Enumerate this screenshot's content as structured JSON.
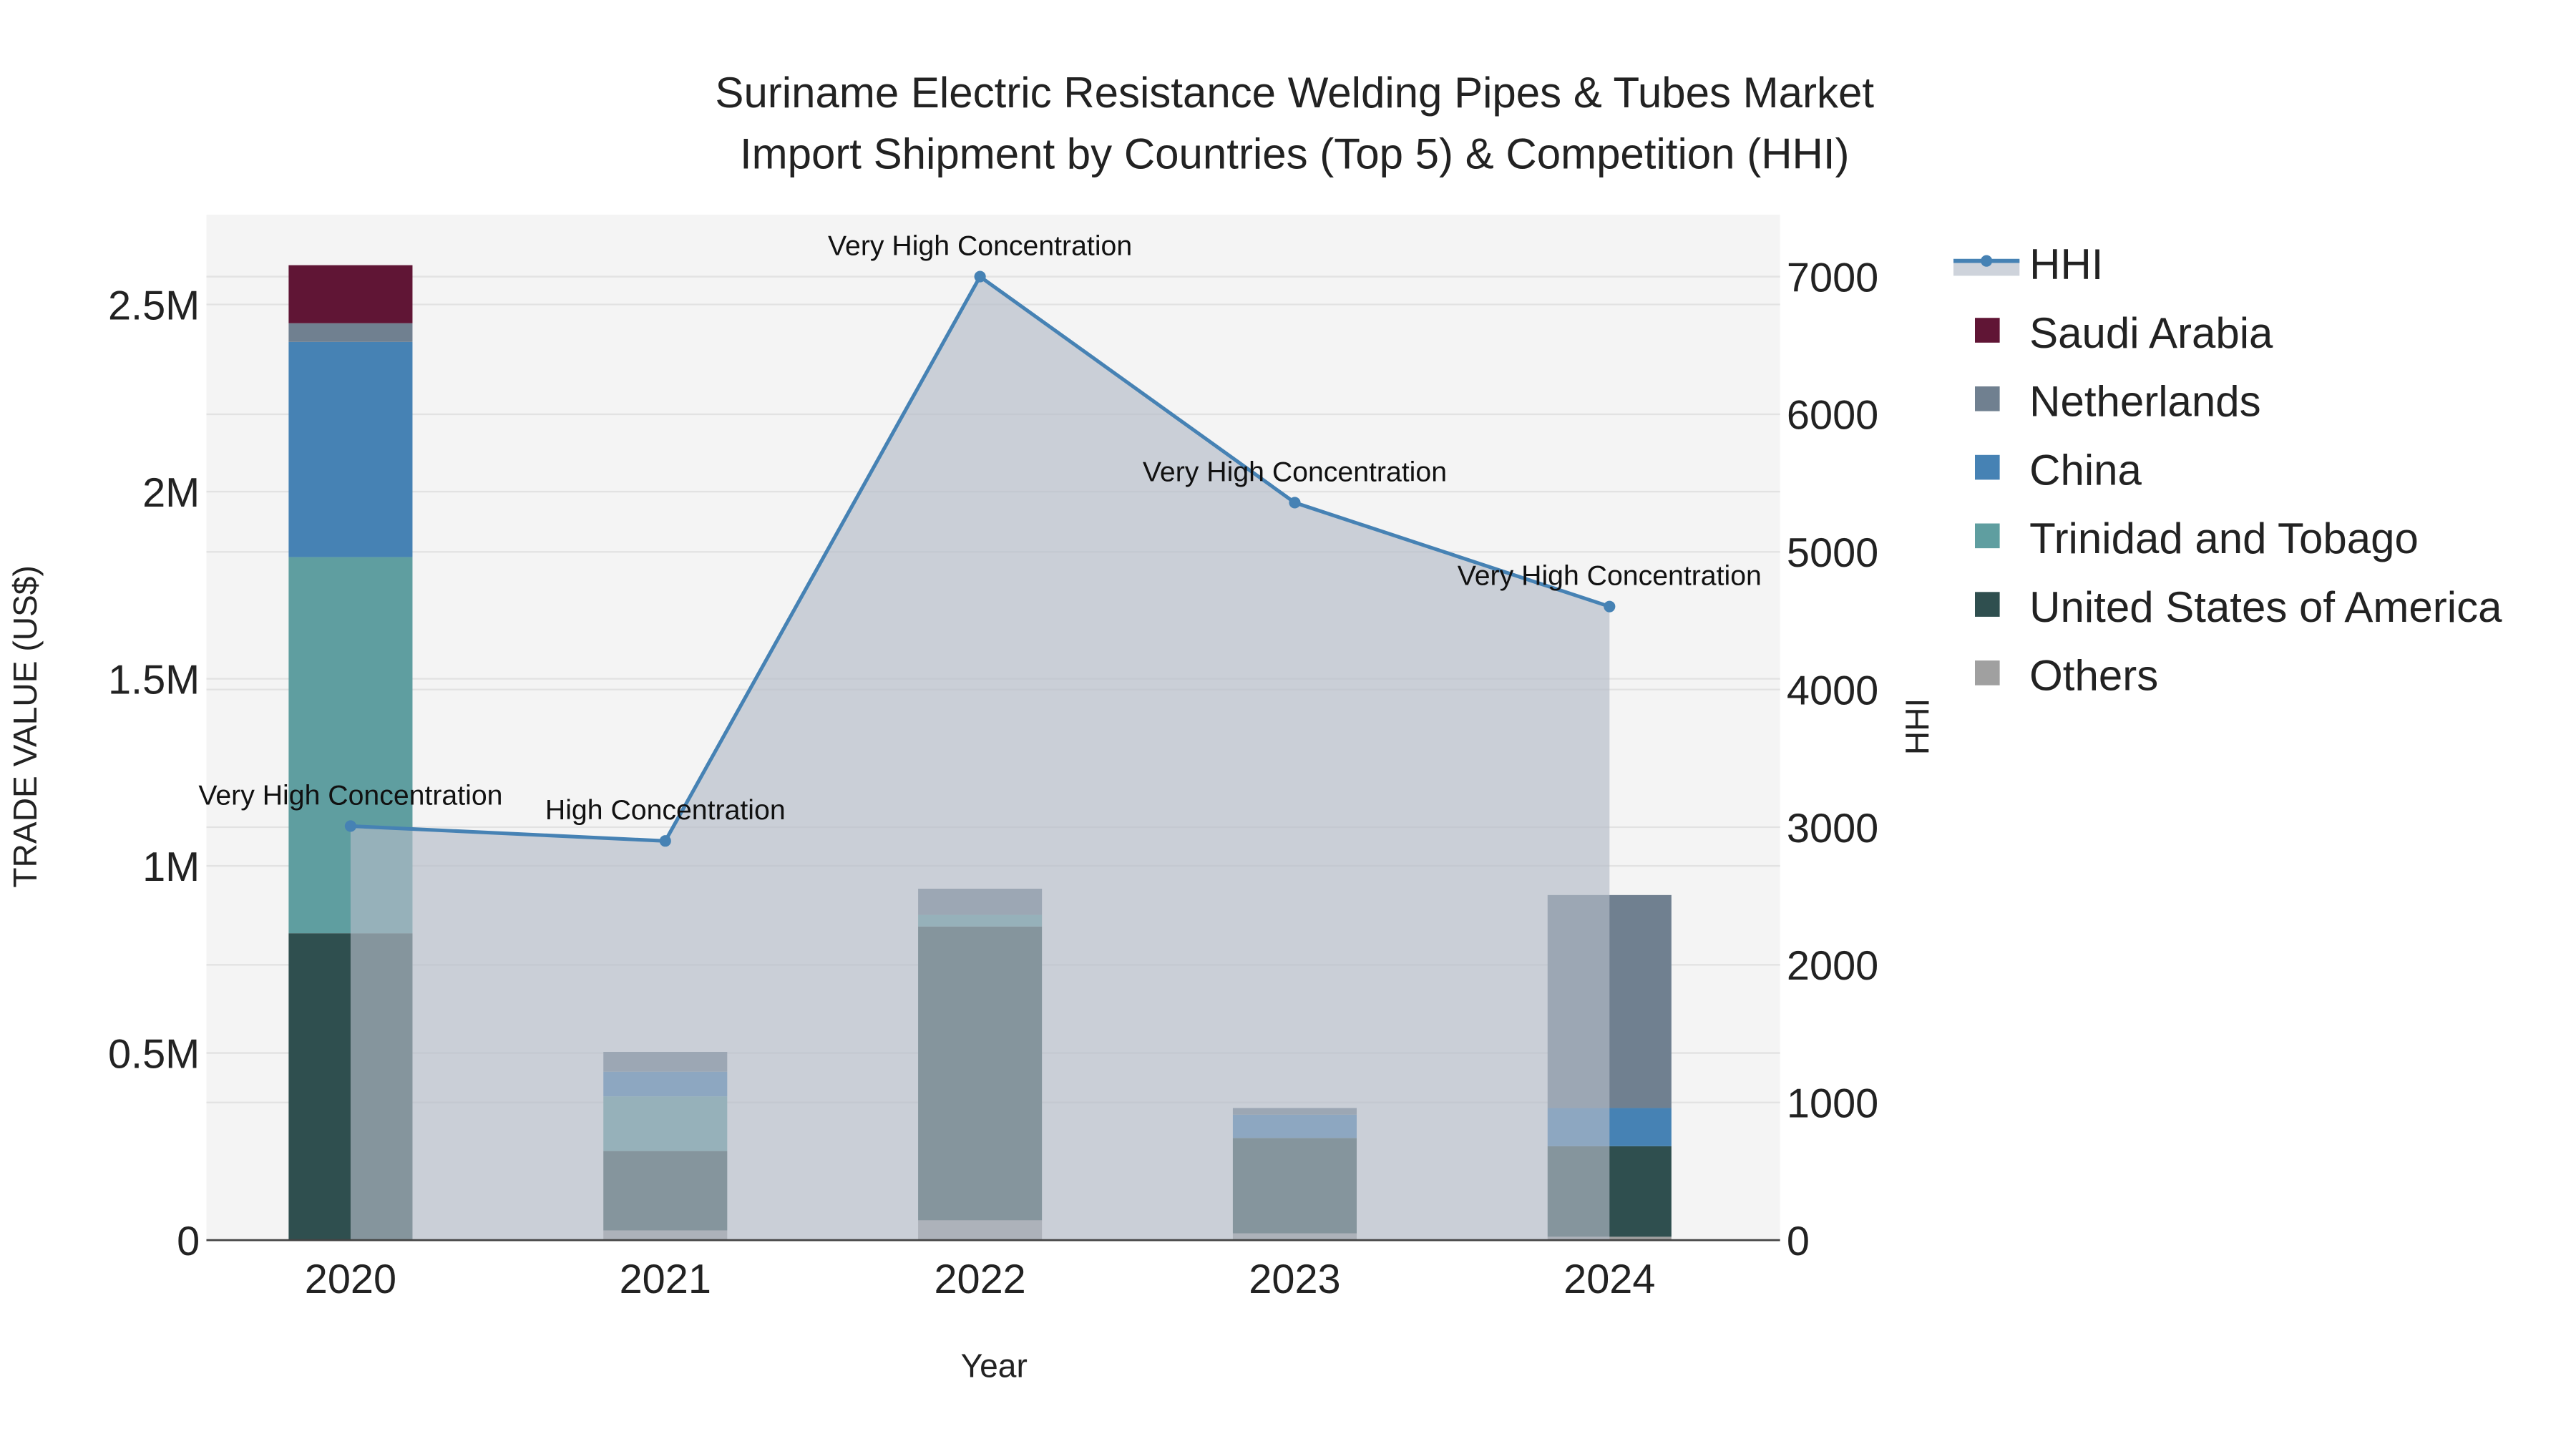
{
  "chart_data": {
    "type": "bar",
    "title_line1": "Suriname Electric Resistance Welding Pipes & Tubes Market",
    "title_line2": "Import Shipment by Countries (Top 5) & Competition (HHI)",
    "xlabel": "Year",
    "ylabel": "TRADE VALUE (US$)",
    "y2label": "HHI",
    "categories": [
      "2020",
      "2021",
      "2022",
      "2023",
      "2024"
    ],
    "ylim": [
      0,
      2740000
    ],
    "y2lim": [
      0,
      7450
    ],
    "yticks": [
      {
        "v": 0,
        "label": "0"
      },
      {
        "v": 500000,
        "label": "0.5M"
      },
      {
        "v": 1000000,
        "label": "1M"
      },
      {
        "v": 1500000,
        "label": "1.5M"
      },
      {
        "v": 2000000,
        "label": "2M"
      },
      {
        "v": 2500000,
        "label": "2.5M"
      }
    ],
    "y2ticks": [
      0,
      1000,
      2000,
      3000,
      4000,
      5000,
      6000,
      7000
    ],
    "series": [
      {
        "name": "Others",
        "color": "#a0a0a0",
        "values": [
          0,
          26000,
          53000,
          18000,
          9000
        ]
      },
      {
        "name": "United States of America",
        "color": "#2f4f4f",
        "values": [
          820000,
          212000,
          785000,
          255000,
          242000
        ]
      },
      {
        "name": "Trinidad and Tobago",
        "color": "#5f9ea0",
        "values": [
          1005000,
          146000,
          31000,
          0,
          0
        ]
      },
      {
        "name": "China",
        "color": "#4682b4",
        "values": [
          575000,
          66000,
          0,
          62000,
          102000
        ]
      },
      {
        "name": "Netherlands",
        "color": "#708090",
        "values": [
          50000,
          53000,
          70000,
          18000,
          569000
        ]
      },
      {
        "name": "Saudi Arabia",
        "color": "#601535",
        "values": [
          155000,
          0,
          0,
          0,
          0
        ]
      }
    ],
    "hhi": {
      "name": "HHI",
      "color": "#4682b4",
      "values": [
        3008,
        2900,
        7000,
        5358,
        4603
      ],
      "labels": [
        "Very High Concentration",
        "High Concentration",
        "Very High Concentration",
        "Very High Concentration",
        "Very High Concentration"
      ]
    },
    "legend_order": [
      "HHI",
      "Saudi Arabia",
      "Netherlands",
      "China",
      "Trinidad and Tobago",
      "United States of America",
      "Others"
    ],
    "legend_position": "right",
    "grid": true
  }
}
